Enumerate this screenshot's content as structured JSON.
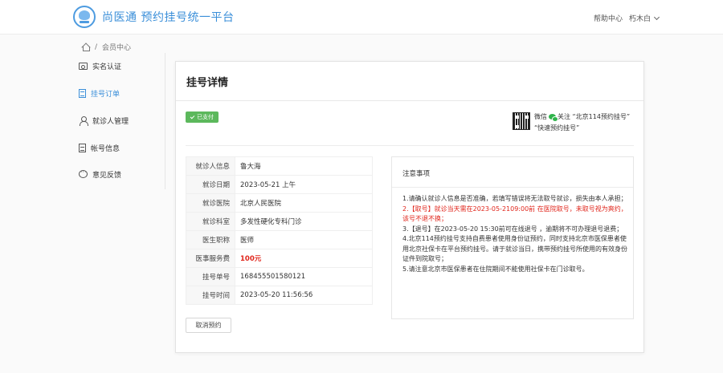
{
  "header": {
    "site_title": "尚医通 预约挂号统一平台",
    "help_link": "帮助中心",
    "user_name": "朽木白"
  },
  "breadcrumb": {
    "current": "会员中心"
  },
  "sidebar": {
    "items": [
      {
        "label": "实名认证",
        "icon": "id-card-icon",
        "active": false
      },
      {
        "label": "挂号订单",
        "icon": "order-list-icon",
        "active": true
      },
      {
        "label": "就诊人管理",
        "icon": "user-icon",
        "active": false
      },
      {
        "label": "帐号信息",
        "icon": "file-icon",
        "active": false
      },
      {
        "label": "意见反馈",
        "icon": "chat-icon",
        "active": false
      }
    ]
  },
  "detail": {
    "title": "挂号详情",
    "status": "已支付",
    "wechat_line1": "微信",
    "wechat_follow": "关注 “北京114预约挂号”",
    "wechat_line2": "“快速预约挂号”",
    "fields": [
      {
        "label": "就诊人信息",
        "value": "鲁大海"
      },
      {
        "label": "就诊日期",
        "value": "2023-05-21 上午"
      },
      {
        "label": "就诊医院",
        "value": "北京人民医院"
      },
      {
        "label": "就诊科室",
        "value": "多发性硬化专科门诊"
      },
      {
        "label": "医生职称",
        "value": "医师"
      },
      {
        "label": "医事服务费",
        "value": "100元"
      },
      {
        "label": "挂号单号",
        "value": "168455501580121"
      },
      {
        "label": "挂号时间",
        "value": "2023-05-20 11:56:56"
      }
    ],
    "cancel_button": "取消预约"
  },
  "notice": {
    "title": "注意事项",
    "items": [
      "1.请确认就诊人信息是否准确，若填写错误将无法取号就诊，损失由本人承担；",
      "2.【取号】就诊当天需在2023-05-2109:00前 在医院取号，未取号视为爽约，该号不退不换；",
      "3.【退号】在2023-05-20 15:30前可在线退号 ，逾期将不可办理退号退费；",
      "4.北京114预约挂号支持自费患者使用身份证预约，同时支持北京市医保患者使用北京社保卡在平台预约挂号。请于就诊当日，携带预约挂号所使用的有效身份证件到院取号；",
      "5.请注意北京市医保患者在住院期间不能使用社保卡在门诊取号。"
    ]
  },
  "colors": {
    "brand": "#3b8fd9",
    "paid": "#5cb85c",
    "warning": "#e0251b"
  }
}
